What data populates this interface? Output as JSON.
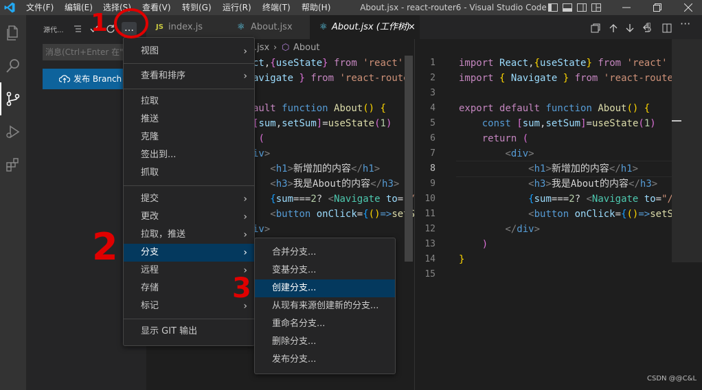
{
  "titlebar": {
    "menus": [
      "文件(F)",
      "编辑(E)",
      "选择(S)",
      "查看(V)",
      "转到(G)",
      "运行(R)",
      "终端(T)",
      "帮助(H)"
    ],
    "title": "About.jsx - react-router6 - Visual Studio Code"
  },
  "sidebar": {
    "title": "源代...",
    "message_placeholder": "消息(Ctrl+Enter 在\"d",
    "publish_label": "发布 Branch"
  },
  "tabs": [
    {
      "label": "index.js",
      "icon": "JS"
    },
    {
      "label": "About.jsx",
      "icon": "react-icon"
    },
    {
      "label": "About.jsx (工作树)",
      "icon": "react-icon"
    }
  ],
  "breadcrumb": {
    "file": ".jsx",
    "symbol": "About"
  },
  "menu_main": {
    "groups": [
      [
        {
          "label": "视图",
          "sub": true
        }
      ],
      [
        {
          "label": "查看和排序",
          "sub": true
        }
      ],
      [
        {
          "label": "拉取"
        },
        {
          "label": "推送"
        },
        {
          "label": "克隆"
        },
        {
          "label": "签出到..."
        },
        {
          "label": "抓取"
        }
      ],
      [
        {
          "label": "提交",
          "sub": true
        },
        {
          "label": "更改",
          "sub": true
        },
        {
          "label": "拉取，推送",
          "sub": true
        },
        {
          "label": "分支",
          "sub": true,
          "active": true
        },
        {
          "label": "远程",
          "sub": true
        },
        {
          "label": "存储",
          "sub": true
        },
        {
          "label": "标记",
          "sub": true
        }
      ],
      [
        {
          "label": "显示 GIT 输出"
        }
      ]
    ]
  },
  "menu_branch": {
    "items": [
      "合并分支...",
      "变基分支...",
      "创建分支...",
      "从现有来源创建新的分支...",
      "重命名分支...",
      "删除分支...",
      "发布分支..."
    ],
    "highlighted_index": 2
  },
  "left_code": [
    "ct,{useState} from 'react'",
    "avigate } from 'react-route",
    "",
    "ault function About() {",
    "[sum,setSum]=useState(1)",
    " (",
    "iv>",
    "   <h1>新增加的内容</h1>",
    "   <h3>我是About的内容</h3>",
    "   {sum===2? <Navigate to=\"/",
    "   <button onClick={()=>setS",
    "iv>"
  ],
  "right_code_lines": [
    "1",
    "2",
    "3",
    "4",
    "5",
    "6",
    "7",
    "8",
    "9",
    "10",
    "11",
    "12",
    "13",
    "14",
    "15"
  ],
  "annotations": [
    "1",
    "2",
    "3"
  ],
  "watermark": "CSDN @@C&L",
  "colors": {
    "accent": "#0e639c",
    "menu_highlight": "#04395e",
    "annotation": "#e00000"
  }
}
